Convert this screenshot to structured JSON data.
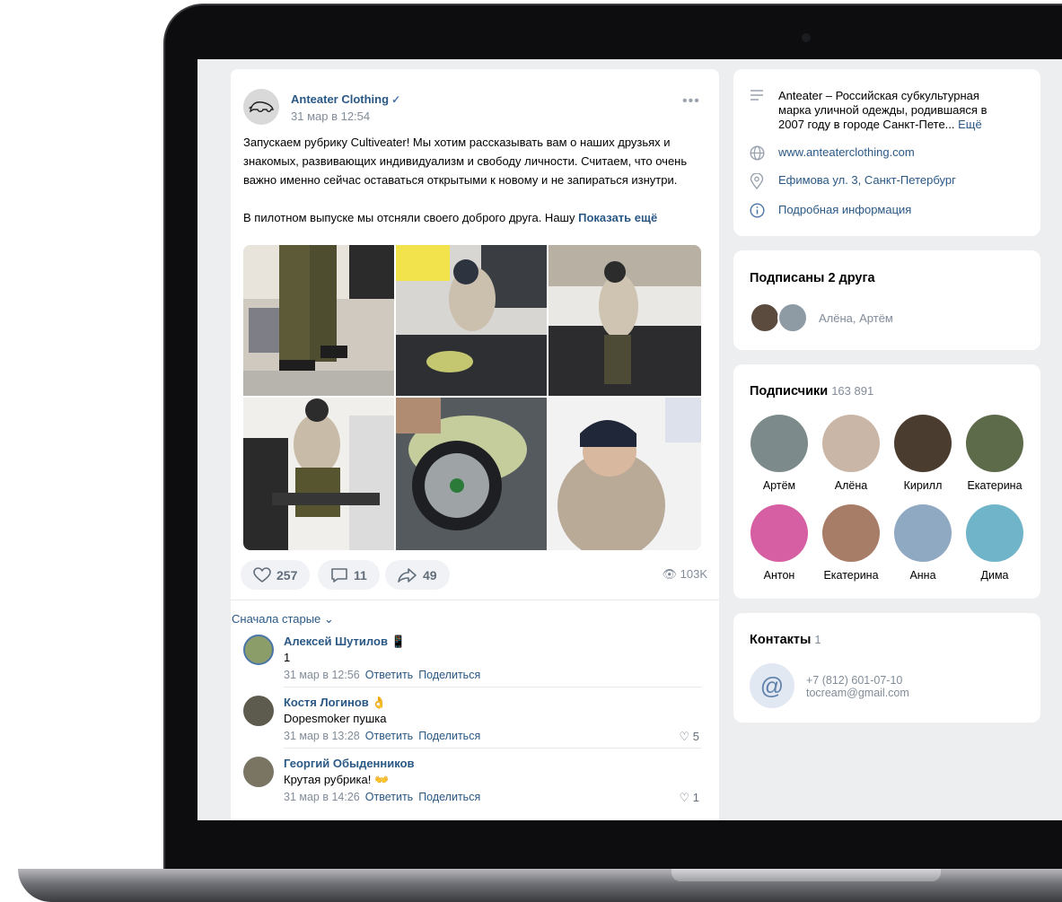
{
  "post": {
    "author": "Anteater Clothing",
    "verified_mark": "✓",
    "date": "31 мар в 12:54",
    "more": "•••",
    "text_p1": "Запускаем рубрику Cultiveater! Мы хотим рассказывать вам о наших друзьях и знакомых, развивающих индивидуализм и свободу личности. Считаем, что очень важно именно сейчас оставаться открытыми к новому и не запираться изнутри.",
    "text_p2": "В пилотном выпуске мы отсняли своего доброго друга. Нашу",
    "show_more": "Показать ещё",
    "likes": "257",
    "comments_count": "11",
    "shares": "49",
    "views": "103K",
    "sort_label": "Сначала старые ⌄",
    "comments": [
      {
        "name": "Алексей Шутилов 📱",
        "text": "1",
        "date": "31 мар в 12:56",
        "reply": "Ответить",
        "share": "Поделиться",
        "likes": ""
      },
      {
        "name": "Костя Логинов 👌",
        "text": "Dopesmoker пушка",
        "date": "31 мар в 13:28",
        "reply": "Ответить",
        "share": "Поделиться",
        "likes": "♡ 5"
      },
      {
        "name": "Георгий Обыденников",
        "text": "Крутая рубрика! 👐",
        "date": "31 мар в 14:26",
        "reply": "Ответить",
        "share": "Поделиться",
        "likes": "♡ 1"
      }
    ]
  },
  "info": {
    "description": "Anteater – Российская субкультурная марка уличной одежды, родившаяся в 2007 году в городе Санкт-Пете...",
    "more": "Ещё",
    "website": "www.anteaterclothing.com",
    "address": "Ефимова ул. 3, Санкт-Петербург",
    "details": "Подробная информация"
  },
  "friends": {
    "title": "Подписаны 2 друга",
    "names": "Алёна, Артём"
  },
  "subscribers": {
    "title": "Подписчики",
    "count": "163 891",
    "people": [
      {
        "name": "Артём",
        "color": "#7d8a8c"
      },
      {
        "name": "Алёна",
        "color": "#c9b6a6"
      },
      {
        "name": "Кирилл",
        "color": "#4a3d30"
      },
      {
        "name": "Екатерина",
        "color": "#5d6b4a"
      },
      {
        "name": "Антон",
        "color": "#d65fa3"
      },
      {
        "name": "Екатерина",
        "color": "#a87d68"
      },
      {
        "name": "Анна",
        "color": "#8fa9c2"
      },
      {
        "name": "Дима",
        "color": "#6fb4c9"
      }
    ]
  },
  "contacts": {
    "title": "Контакты",
    "count": "1",
    "phone": "+7 (812) 601-07-10",
    "email": "tocream@gmail.com"
  }
}
